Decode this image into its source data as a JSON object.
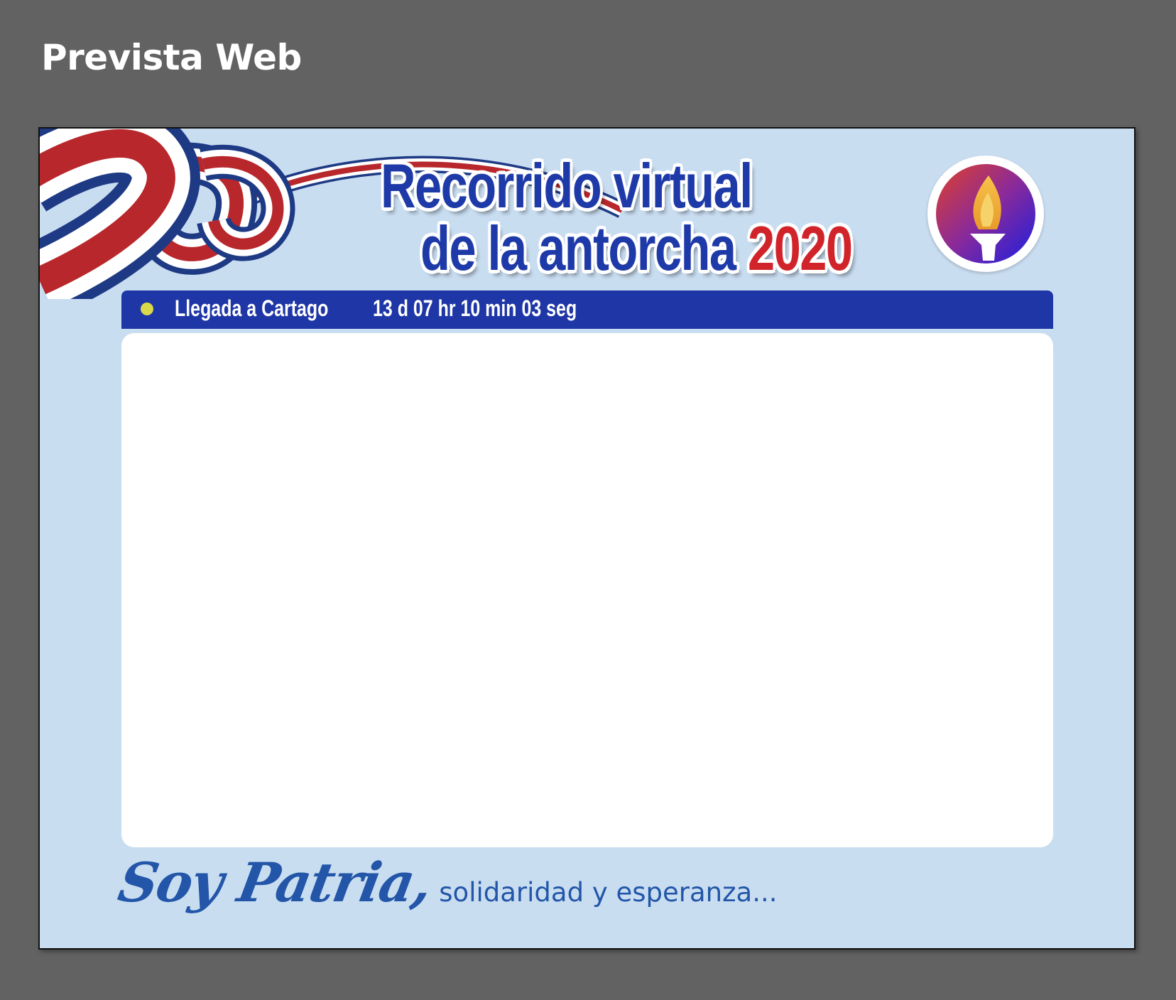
{
  "page": {
    "heading": "Prevista Web"
  },
  "banner": {
    "title_line_1": "Recorrido virtual",
    "title_line_2": "de la antorcha",
    "title_year": "2020"
  },
  "info_bar": {
    "label": "Llegada a Cartago",
    "countdown": "13 d 07 hr 10 min 03 seg"
  },
  "footer": {
    "slogan_script": "Soy Patria,",
    "slogan_tail": "solidaridad y esperanza..."
  },
  "colors": {
    "canvas_bg": "#626262",
    "artboard_bg": "#c9ddf1",
    "brand_blue": "#1e36a6",
    "flag_red": "#c22a2a",
    "status_dot": "#d9d94a"
  },
  "icons": {
    "flag": "costa-rica-flag-ribbon",
    "logo": "torch-logo"
  }
}
